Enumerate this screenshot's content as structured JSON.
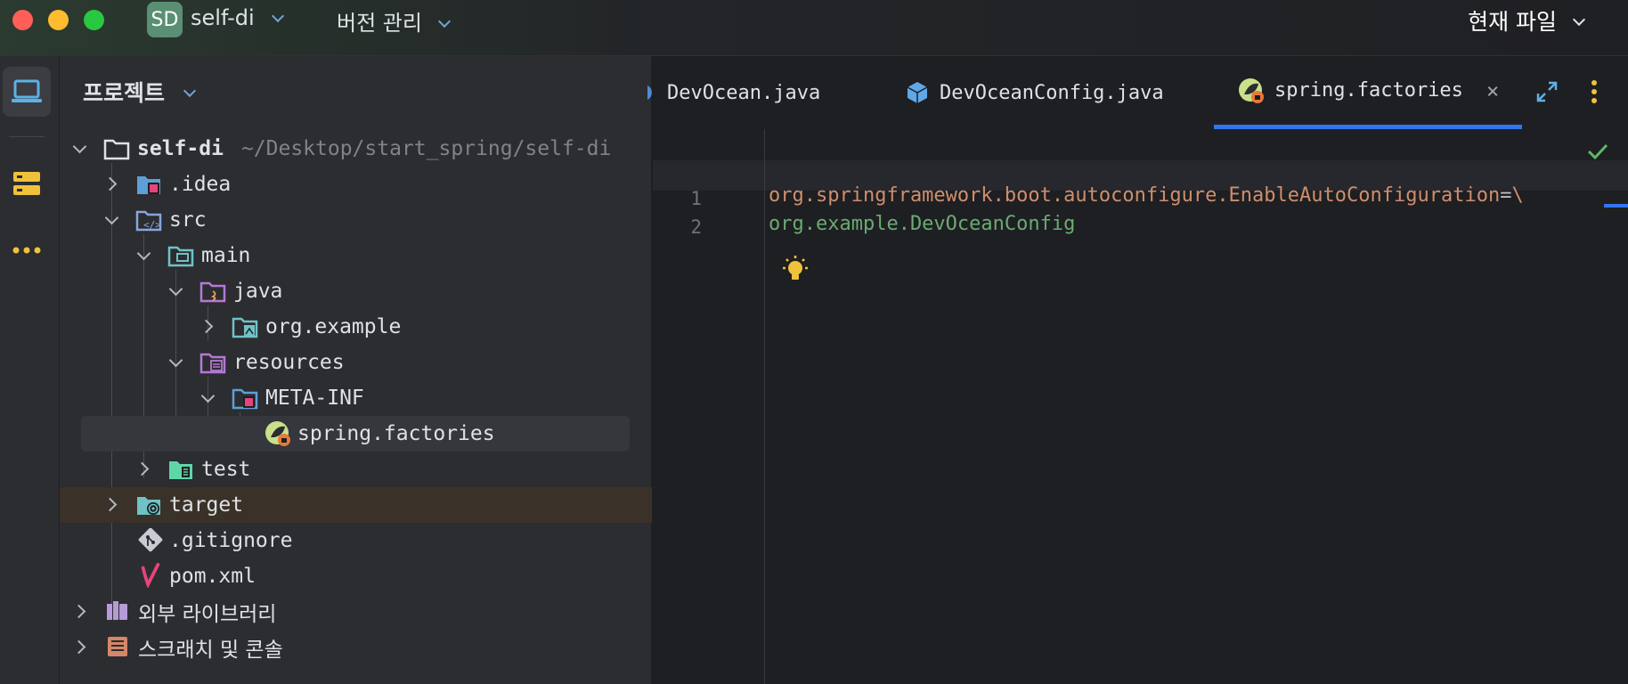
{
  "titlebar": {
    "project_badge": "SD",
    "project_name": "self-di",
    "vcs_label": "버전 관리",
    "current_file_label": "현재 파일"
  },
  "panel": {
    "title": "프로젝트"
  },
  "tree": [
    {
      "label": "self-di",
      "hint": "~/Desktop/start_spring/self-di"
    },
    {
      "label": ".idea"
    },
    {
      "label": "src"
    },
    {
      "label": "main"
    },
    {
      "label": "java"
    },
    {
      "label": "org.example"
    },
    {
      "label": "resources"
    },
    {
      "label": "META-INF"
    },
    {
      "label": "spring.factories"
    },
    {
      "label": "test"
    },
    {
      "label": "target"
    },
    {
      "label": ".gitignore"
    },
    {
      "label": "pom.xml"
    },
    {
      "label": "외부 라이브러리"
    },
    {
      "label": "스크래치 및 콘솔"
    }
  ],
  "tabs": [
    {
      "label": "DevOcean.java"
    },
    {
      "label": "DevOceanConfig.java"
    },
    {
      "label": "spring.factories",
      "close": "×"
    }
  ],
  "editor": {
    "line_numbers": [
      "1",
      "2"
    ],
    "line1_key": "org.springframework.boot.autoconfigure.EnableAutoConfiguration",
    "line1_eq": "=",
    "line1_esc": "\\",
    "line2_value": "org.example.DevOceanConfig"
  },
  "colors": {
    "accent": "#3574f0",
    "property_key": "#cf8e6d",
    "property_value": "#6aab73"
  }
}
